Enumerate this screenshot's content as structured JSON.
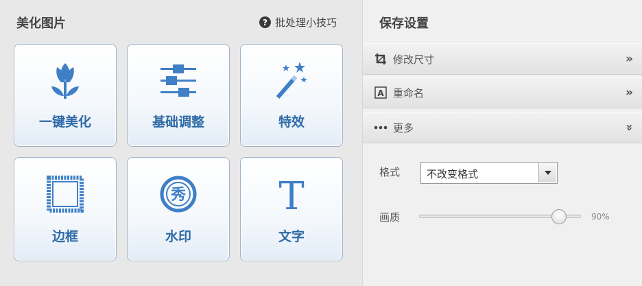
{
  "left_panel": {
    "title": "美化图片",
    "tips_label": "批处理小技巧",
    "tools": [
      {
        "label": "一键美化",
        "icon": "tulip-icon"
      },
      {
        "label": "基础调整",
        "icon": "sliders-icon"
      },
      {
        "label": "特效",
        "icon": "magic-wand-icon"
      },
      {
        "label": "边框",
        "icon": "frame-icon"
      },
      {
        "label": "水印",
        "icon": "watermark-icon"
      },
      {
        "label": "文字",
        "icon": "text-icon"
      }
    ]
  },
  "right_panel": {
    "title": "保存设置",
    "sections": [
      {
        "label": "修改尺寸",
        "icon": "crop-icon",
        "arrow": "»"
      },
      {
        "label": "重命名",
        "icon": "rename-icon",
        "arrow": "»"
      },
      {
        "label": "更多",
        "icon": "more-dots-icon",
        "arrow": "»"
      }
    ],
    "format": {
      "label": "格式",
      "value": "不改变格式"
    },
    "quality": {
      "label": "画质",
      "value_text": "90%",
      "value": 0.9
    }
  },
  "colors": {
    "accent": "#2f6aa6",
    "icon_blue": "#3f7fc6"
  }
}
